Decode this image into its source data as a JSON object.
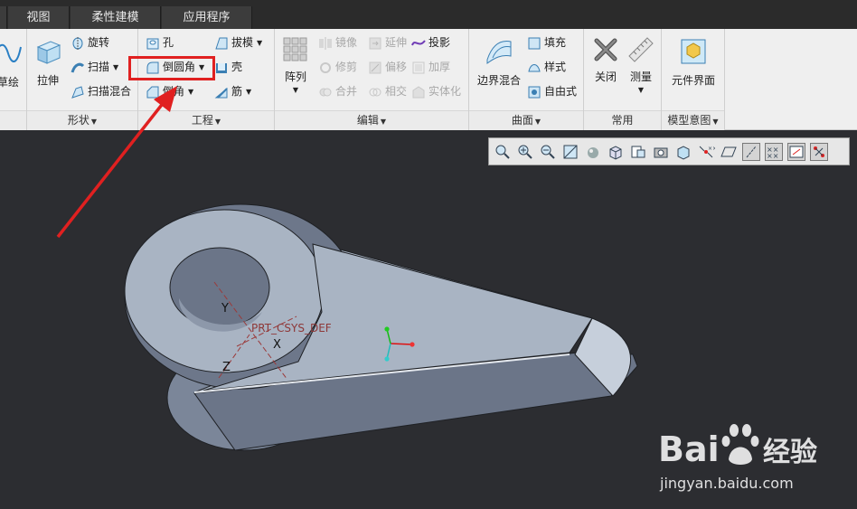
{
  "tabs": [
    "视图",
    "柔性建模",
    "应用程序"
  ],
  "left_edge": {
    "sketch_partial": "草绘"
  },
  "groups": {
    "shape": {
      "footer": "形状",
      "extrude": "拉伸",
      "revolve": "旋转",
      "sweep": "扫描",
      "swept_blend": "扫描混合"
    },
    "engineering": {
      "footer": "工程",
      "hole": "孔",
      "draft": "拔模",
      "round": "倒圆角",
      "shell": "壳",
      "chamfer": "倒角",
      "rib": "筋"
    },
    "editing": {
      "footer": "编辑",
      "pattern": "阵列",
      "mirror": "镜像",
      "extend": "延伸",
      "project": "投影",
      "trim": "修剪",
      "offset": "偏移",
      "thicken": "加厚",
      "merge": "合并",
      "intersect": "相交",
      "solidify": "实体化"
    },
    "surfaces": {
      "footer": "曲面",
      "boundary_blend": "边界混合",
      "fill": "填充",
      "style": "样式",
      "freestyle": "自由式"
    },
    "common": {
      "footer": "常用",
      "close": "关闭",
      "measure": "测量"
    },
    "model_intent": {
      "footer": "模型意图",
      "component_interface": "元件界面"
    }
  },
  "viewport": {
    "csys_label": "PRT_CSYS_DEF",
    "axis_x": "X",
    "axis_y": "Y",
    "axis_z": "Z"
  },
  "watermark": {
    "brand_left": "Bai",
    "brand_right": "经验",
    "url": "jingyan.baidu.com"
  },
  "colors": {
    "highlight": "#e02020",
    "arrow": "#e02020",
    "model_top": "#a9b4c3",
    "model_side": "#6c7688",
    "background": "#2c2d31"
  }
}
